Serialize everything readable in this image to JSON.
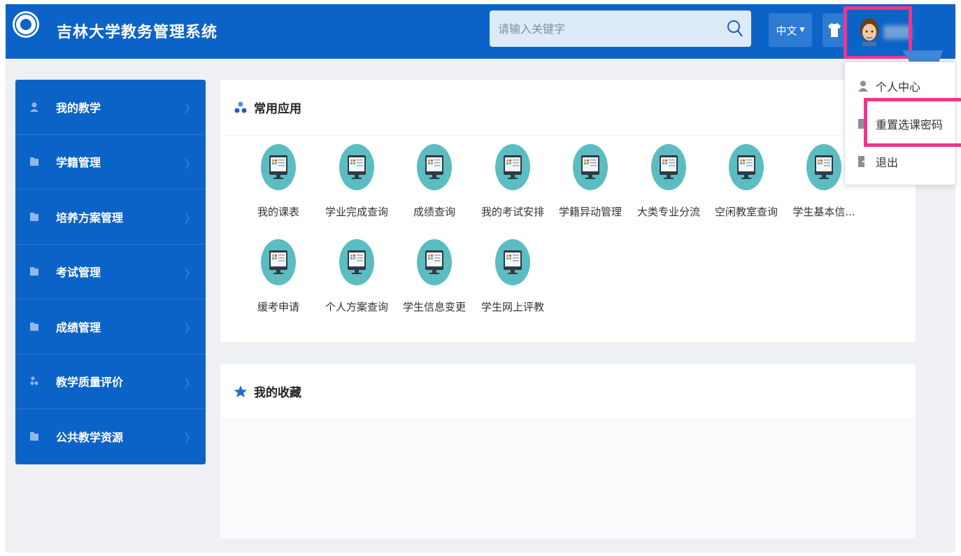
{
  "header": {
    "system_title": "吉林大学教务管理系统",
    "search_placeholder": "请输入关键字",
    "language_label": "中文",
    "brand_color": "#0c63c7"
  },
  "sidebar": {
    "items": [
      {
        "label": "我的教学",
        "icon": "user-icon"
      },
      {
        "label": "学籍管理",
        "icon": "folder-icon"
      },
      {
        "label": "培养方案管理",
        "icon": "folder-icon"
      },
      {
        "label": "考试管理",
        "icon": "folder-icon"
      },
      {
        "label": "成绩管理",
        "icon": "folder-icon"
      },
      {
        "label": "教学质量评价",
        "icon": "group-icon"
      },
      {
        "label": "公共教学资源",
        "icon": "folder-icon"
      }
    ]
  },
  "common_apps": {
    "title": "常用应用",
    "items": [
      "我的课表",
      "学业完成查询",
      "成绩查询",
      "我的考试安排",
      "学籍异动管理",
      "大类专业分流",
      "空闲教室查询",
      "学生基本信...",
      "缓考申请",
      "个人方案查询",
      "学生信息变更",
      "学生网上评教"
    ]
  },
  "favorites": {
    "title": "我的收藏"
  },
  "user_menu": {
    "items": [
      {
        "label": "个人中心",
        "icon": "user-icon"
      },
      {
        "label": "重置选课密码",
        "icon": "key-icon"
      },
      {
        "label": "退出",
        "icon": "logout-icon"
      }
    ]
  },
  "highlight_color": "#f0358a"
}
